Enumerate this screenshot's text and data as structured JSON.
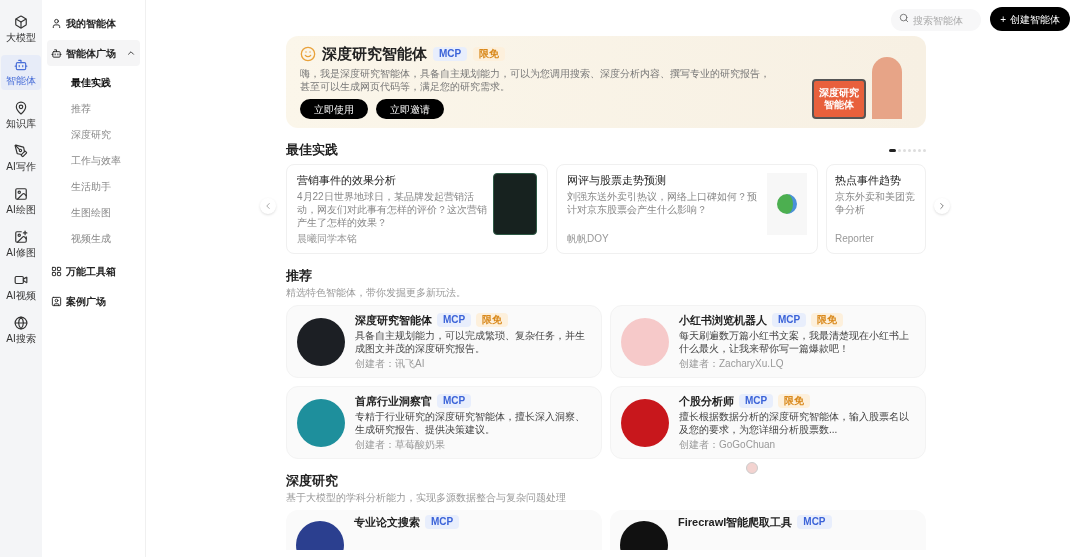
{
  "rail": [
    {
      "kind": "model",
      "label": "大模型",
      "selected": false
    },
    {
      "kind": "agent",
      "label": "智能体",
      "selected": true
    },
    {
      "kind": "knowledge",
      "label": "知识库",
      "selected": false
    },
    {
      "kind": "write",
      "label": "AI写作",
      "selected": false
    },
    {
      "kind": "draw",
      "label": "AI绘图",
      "selected": false
    },
    {
      "kind": "edit",
      "label": "AI修图",
      "selected": false
    },
    {
      "kind": "video",
      "label": "AI视频",
      "selected": false
    },
    {
      "kind": "search",
      "label": "AI搜索",
      "selected": false
    }
  ],
  "nav": [
    {
      "kind": "user",
      "label": "我的智能体",
      "selected": false
    },
    {
      "kind": "square",
      "label": "智能体广场",
      "selected": false,
      "expanded": true,
      "children": [
        {
          "label": "最佳实践",
          "selected": true
        },
        {
          "label": "推荐",
          "selected": false
        },
        {
          "label": "深度研究",
          "selected": false
        },
        {
          "label": "工作与效率",
          "selected": false
        },
        {
          "label": "生活助手",
          "selected": false
        },
        {
          "label": "生图绘图",
          "selected": false
        },
        {
          "label": "视频生成",
          "selected": false
        }
      ]
    },
    {
      "kind": "tools",
      "label": "万能工具箱",
      "selected": false
    },
    {
      "kind": "cases",
      "label": "案例广场",
      "selected": false
    }
  ],
  "search": {
    "placeholder": "搜索智能体"
  },
  "create_button": {
    "icon": "+",
    "label": "创建智能体"
  },
  "banner": {
    "title": "深度研究智能体",
    "tags": [
      {
        "kind": "mcp",
        "label": "MCP"
      },
      {
        "kind": "free",
        "label": "限免"
      }
    ],
    "description": "嗨，我是深度研究智能体，具备自主规划能力，可以为您调用搜索、深度分析内容、撰写专业的研究报告，甚至可以生成网页代码等，满足您的研究需求。",
    "buttons": [
      "立即使用",
      "立即邀请"
    ],
    "illustration_text": "深度研究智能体"
  },
  "best_practice": {
    "title": "最佳实践",
    "pages": [
      {
        "selected": true
      },
      {
        "selected": false
      },
      {
        "selected": false
      },
      {
        "selected": false
      },
      {
        "selected": false
      },
      {
        "selected": false
      },
      {
        "selected": false
      }
    ],
    "cards": [
      {
        "kind": "terminal",
        "title": "营销事件的效果分析",
        "description": "4月22日世界地球日，某品牌发起营销活动，网友们对此事有怎样的评价？这次营销产生了怎样的效果？",
        "author": "晨曦同学本铭"
      },
      {
        "kind": "chart",
        "title": "网评与股票走势预测",
        "description": "刘强东送外卖引热议，网络上口碑如何？预计对京东股票会产生什么影响？",
        "author": "帆帆DOY"
      },
      {
        "kind": "cut",
        "title": "热点事件趋势",
        "description": "京东外卖和美团竞争分析",
        "author": "Reporter"
      }
    ]
  },
  "recommend": {
    "title": "推荐",
    "subtitle": "精选特色智能体，带你发掘更多新玩法。",
    "cards": [
      {
        "title": "深度研究智能体",
        "tags": [
          {
            "kind": "mcp",
            "label": "MCP"
          },
          {
            "kind": "free",
            "label": "限免"
          }
        ],
        "description": "具备自主规划能力，可以完成繁琐、复杂任务，并生成图文并茂的深度研究报告。",
        "author": "创建者：讯飞AI"
      },
      {
        "title": "小红书浏览机器人",
        "tags": [
          {
            "kind": "mcp",
            "label": "MCP"
          },
          {
            "kind": "free",
            "label": "限免"
          }
        ],
        "description": "每天刷遍数万篇小红书文案，我最清楚现在小红书上什么最火，让我来帮你写一篇爆款吧！",
        "author": "创建者：ZacharyXu.LQ"
      },
      {
        "title": "首席行业洞察官",
        "tags": [
          {
            "kind": "mcp",
            "label": "MCP"
          }
        ],
        "description": "专精于行业研究的深度研究智能体，擅长深入洞察、生成研究报告、提供决策建议。",
        "author": "创建者：草莓酸奶果"
      },
      {
        "title": "个股分析师",
        "tags": [
          {
            "kind": "mcp",
            "label": "MCP"
          },
          {
            "kind": "free",
            "label": "限免"
          }
        ],
        "description": "擅长根据数据分析的深度研究智能体，输入股票名以及您的要求，为您详细分析股票数...",
        "author": "创建者：GoGoChuan"
      }
    ]
  },
  "deep_research": {
    "title": "深度研究",
    "subtitle": "基于大模型的学科分析能力，实现多源数据整合与复杂问题处理",
    "cards": [
      {
        "title": "专业论文搜索",
        "tags": [
          {
            "kind": "mcp",
            "label": "MCP"
          }
        ]
      },
      {
        "title": "Firecrawl智能爬取工具",
        "tags": [
          {
            "kind": "mcp",
            "label": "MCP"
          }
        ]
      }
    ]
  }
}
